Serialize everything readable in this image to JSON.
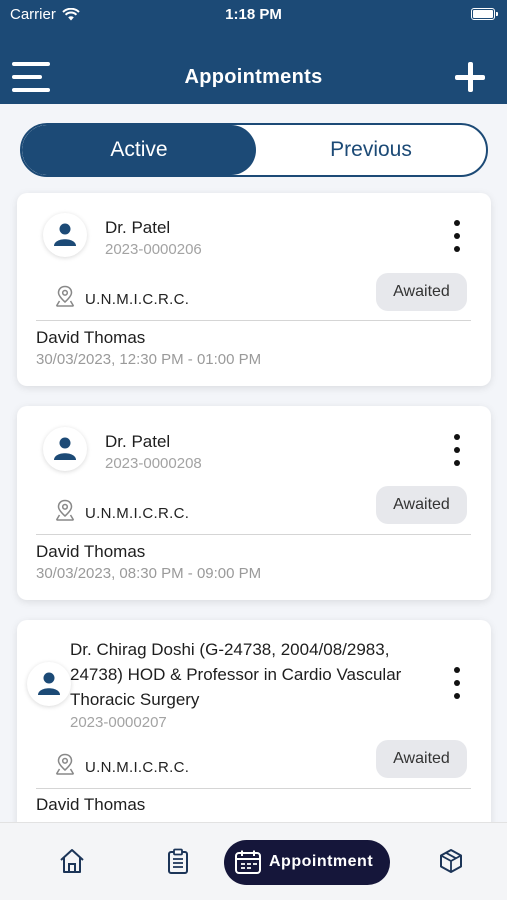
{
  "status_bar": {
    "carrier": "Carrier",
    "time": "1:18 PM"
  },
  "header": {
    "title": "Appointments",
    "menu_icon": "hamburger-menu-icon",
    "add_icon": "plus-icon"
  },
  "tabs": {
    "active": "Active",
    "previous": "Previous"
  },
  "appointments": [
    {
      "doctor": "Dr. Patel",
      "id": "2023-0000206",
      "location": "U.N.M.I.C.R.C.",
      "status": "Awaited",
      "patient": "David Thomas",
      "datetime": "30/03/2023, 12:30 PM - 01:00 PM"
    },
    {
      "doctor": "Dr. Patel",
      "id": "2023-0000208",
      "location": "U.N.M.I.C.R.C.",
      "status": "Awaited",
      "patient": "David Thomas",
      "datetime": "30/03/2023, 08:30 PM - 09:00 PM"
    },
    {
      "doctor_lines": [
        "Dr. Chirag Doshi (G-24738, 2004/08/2983,",
        "24738) HOD & Professor in Cardio Vascular",
        "Thoracic Surgery"
      ],
      "id": "2023-0000207",
      "location": "U.N.M.I.C.R.C.",
      "status": "Awaited",
      "patient": "David Thomas"
    }
  ],
  "bottom_nav": {
    "active_label": "Appointment",
    "icons": [
      "home-icon",
      "clipboard-icon",
      "calendar-icon",
      "package-box-icon"
    ]
  },
  "colors": {
    "primary": "#1c4a76",
    "nav_active": "#15163a",
    "badge_bg": "#e7e8ec"
  }
}
